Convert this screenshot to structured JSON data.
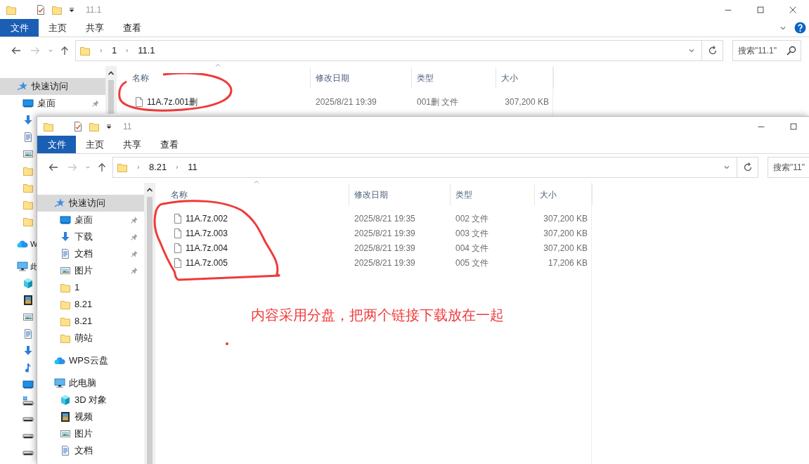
{
  "back_window": {
    "title": "11.1",
    "ribbon_tabs": [
      {
        "label": "文件",
        "kind": "file"
      },
      {
        "label": "主页",
        "kind": "tab"
      },
      {
        "label": "共享",
        "kind": "tab"
      },
      {
        "label": "查看",
        "kind": "tab"
      }
    ],
    "address": {
      "segments": [
        "1",
        "11.1"
      ]
    },
    "search": {
      "placeholder": "搜索\"11.1\""
    },
    "sidebar": {
      "items": [
        {
          "label": "快速访问",
          "selected": true,
          "children": [
            {
              "label": "桌面",
              "selected": false,
              "pinned": true
            }
          ]
        },
        {
          "label": "W",
          "selected": false
        },
        {
          "label": "此",
          "selected": false
        }
      ]
    },
    "columns": [
      "名称",
      "修改日期",
      "类型",
      "大小"
    ],
    "files": [
      {
        "name": "11A.7z.001删",
        "modified": "2025/8/21 19:39",
        "type": "001删 文件",
        "size": "307,200 KB"
      }
    ]
  },
  "front_window": {
    "title": "11",
    "ribbon_tabs": [
      {
        "label": "文件",
        "kind": "file"
      },
      {
        "label": "主页",
        "kind": "tab"
      },
      {
        "label": "共享",
        "kind": "tab"
      },
      {
        "label": "查看",
        "kind": "tab"
      }
    ],
    "address": {
      "segments": [
        "8.21",
        "11"
      ]
    },
    "search": {
      "placeholder": "搜索\"11\""
    },
    "sidebar": {
      "items": [
        {
          "label": "快速访问",
          "selected": true,
          "children": [
            {
              "label": "桌面",
              "selected": false,
              "pinned": true
            },
            {
              "label": "下载",
              "selected": false,
              "pinned": true
            },
            {
              "label": "文档",
              "selected": false,
              "pinned": true
            },
            {
              "label": "图片",
              "selected": false,
              "pinned": true
            },
            {
              "label": "1",
              "selected": false,
              "pinned": false
            },
            {
              "label": "8.21",
              "selected": false,
              "pinned": false
            },
            {
              "label": "8.21",
              "selected": false,
              "pinned": false
            },
            {
              "label": "萌站",
              "selected": false,
              "pinned": false
            }
          ]
        },
        {
          "label": "WPS云盘",
          "selected": false
        },
        {
          "label": "此电脑",
          "selected": false,
          "children": [
            {
              "label": "3D 对象",
              "selected": false
            },
            {
              "label": "视频",
              "selected": false
            },
            {
              "label": "图片",
              "selected": false
            },
            {
              "label": "文档",
              "selected": false
            }
          ]
        }
      ]
    },
    "columns": [
      "名称",
      "修改日期",
      "类型",
      "大小"
    ],
    "files": [
      {
        "name": "11A.7z.002",
        "modified": "2025/8/21 19:35",
        "type": "002 文件",
        "size": "307,200 KB"
      },
      {
        "name": "11A.7z.003",
        "modified": "2025/8/21 19:39",
        "type": "003 文件",
        "size": "307,200 KB"
      },
      {
        "name": "11A.7z.004",
        "modified": "2025/8/21 19:39",
        "type": "004 文件",
        "size": "307,200 KB"
      },
      {
        "name": "11A.7z.005",
        "modified": "2025/8/21 19:39",
        "type": "005 文件",
        "size": "17,206 KB"
      }
    ]
  },
  "annotation": {
    "text": "内容采用分盘，把两个链接下载放在一起"
  }
}
